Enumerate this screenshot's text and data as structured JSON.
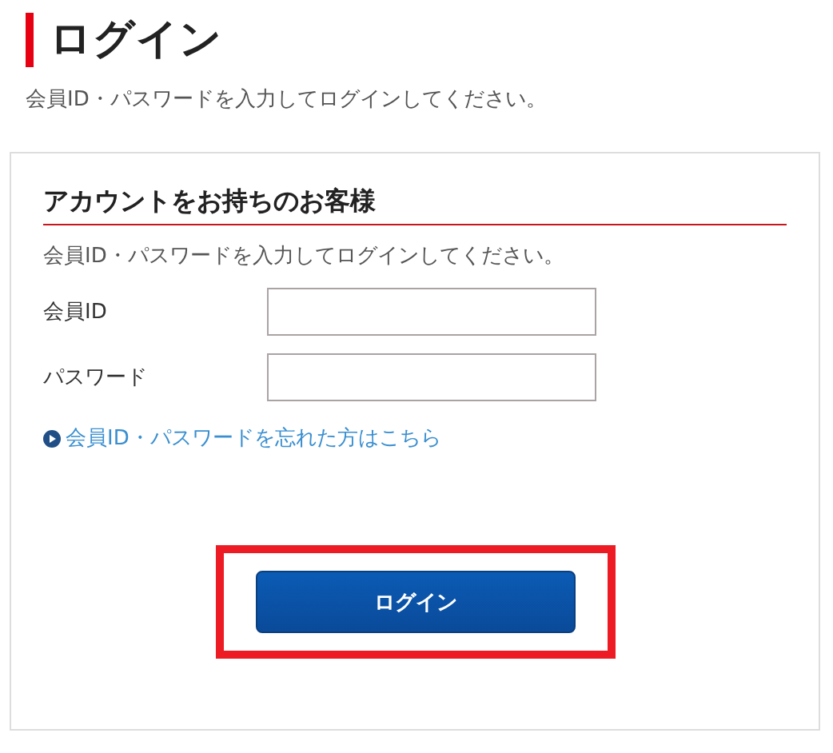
{
  "page": {
    "title": "ログイン",
    "intro": "会員ID・パスワードを入力してログインしてください。"
  },
  "login_card": {
    "heading": "アカウントをお持ちのお客様",
    "description": "会員ID・パスワードを入力してログインしてください。",
    "fields": [
      {
        "label": "会員ID"
      },
      {
        "label": "パスワード"
      }
    ],
    "forgot_link": "会員ID・パスワードを忘れた方はこちら",
    "submit": {
      "label": "ログイン",
      "highlighted": true
    }
  }
}
